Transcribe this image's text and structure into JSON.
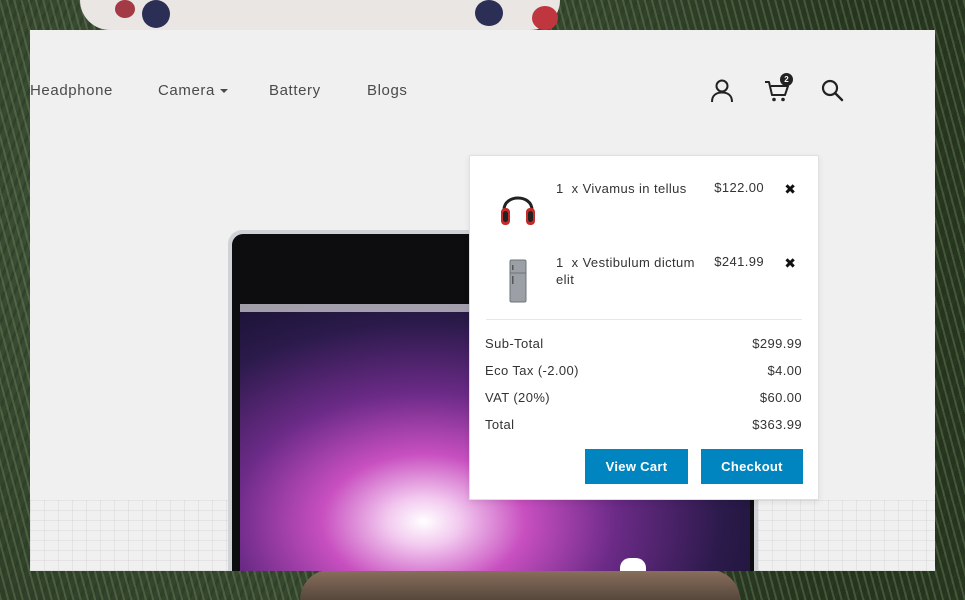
{
  "nav": {
    "items": [
      {
        "label": "Headphone",
        "has_dropdown": false
      },
      {
        "label": "Camera",
        "has_dropdown": true
      },
      {
        "label": "Battery",
        "has_dropdown": false
      },
      {
        "label": "Blogs",
        "has_dropdown": false
      }
    ]
  },
  "header": {
    "account_icon": "user-icon",
    "cart_icon": "cart-icon",
    "cart_count": "2",
    "search_icon": "search-icon"
  },
  "cart": {
    "items": [
      {
        "qty": "1",
        "name": "x Vivamus in tellus",
        "price": "$122.00",
        "thumb": "headphones-thumb"
      },
      {
        "qty": "1",
        "name": "x Vestibulum dictum elit",
        "price": "$241.99",
        "thumb": "refrigerator-thumb"
      }
    ],
    "totals": [
      {
        "label": "Sub-Total",
        "value": "$299.99"
      },
      {
        "label": "Eco Tax (-2.00)",
        "value": "$4.00"
      },
      {
        "label": "VAT (20%)",
        "value": "$60.00"
      },
      {
        "label": "Total",
        "value": "$363.99"
      }
    ],
    "view_cart_label": "View Cart",
    "checkout_label": "Checkout"
  },
  "colors": {
    "accent": "#0085c1",
    "panel_bg": "#f0f0f0"
  }
}
